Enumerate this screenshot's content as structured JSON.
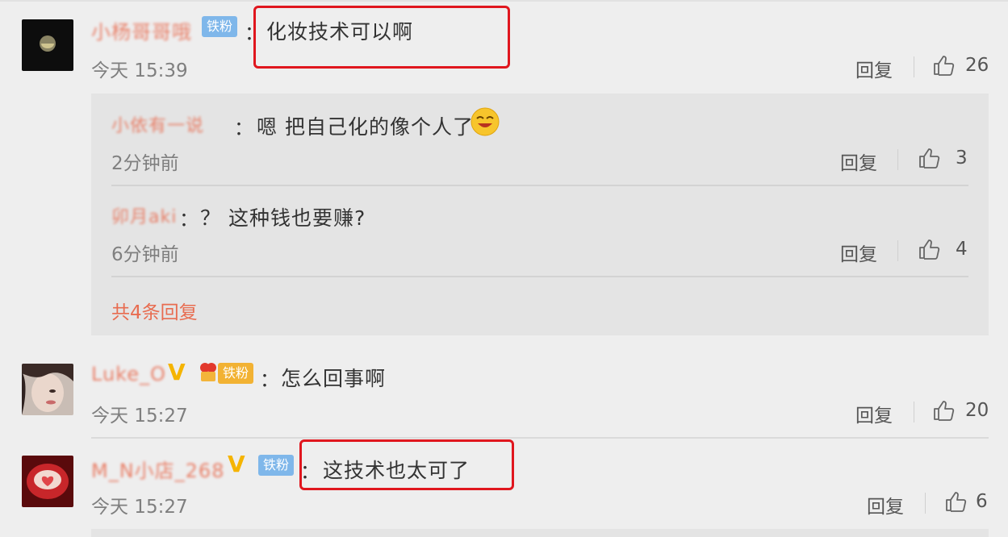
{
  "comments": [
    {
      "username": "小杨哥哥哦",
      "badge": "铁粉",
      "text": "化妆技术可以啊",
      "time": "今天 15:39",
      "reply_label": "回复",
      "likes": "26",
      "replies": [
        {
          "username": "小依有一说",
          "text": "嗯 把自己化的像个人了",
          "time": "2分钟前",
          "reply_label": "回复",
          "likes": "3"
        },
        {
          "username": "卯月aki",
          "text": "？ 这种钱也要赚?",
          "time": "6分钟前",
          "reply_label": "回复",
          "likes": "4"
        }
      ],
      "more_replies": "共4条回复"
    },
    {
      "username": "Luke_O",
      "badge": "铁粉",
      "text": "怎么回事啊",
      "time": "今天 15:27",
      "reply_label": "回复",
      "likes": "20"
    },
    {
      "username": "M_N小店_268",
      "badge": "铁粉",
      "text": "这技术也太可了",
      "time": "今天 15:27",
      "reply_label": "回复",
      "likes": "6"
    }
  ],
  "colon": "：",
  "icons": {
    "verified": "V",
    "like": "thumbs-up-icon",
    "emoji": "laughing-face-emoji"
  },
  "colors": {
    "username": "#e86c50",
    "highlight": "#e0161e",
    "fan_badge": "#7fb7ea",
    "verified": "#f5b400"
  }
}
